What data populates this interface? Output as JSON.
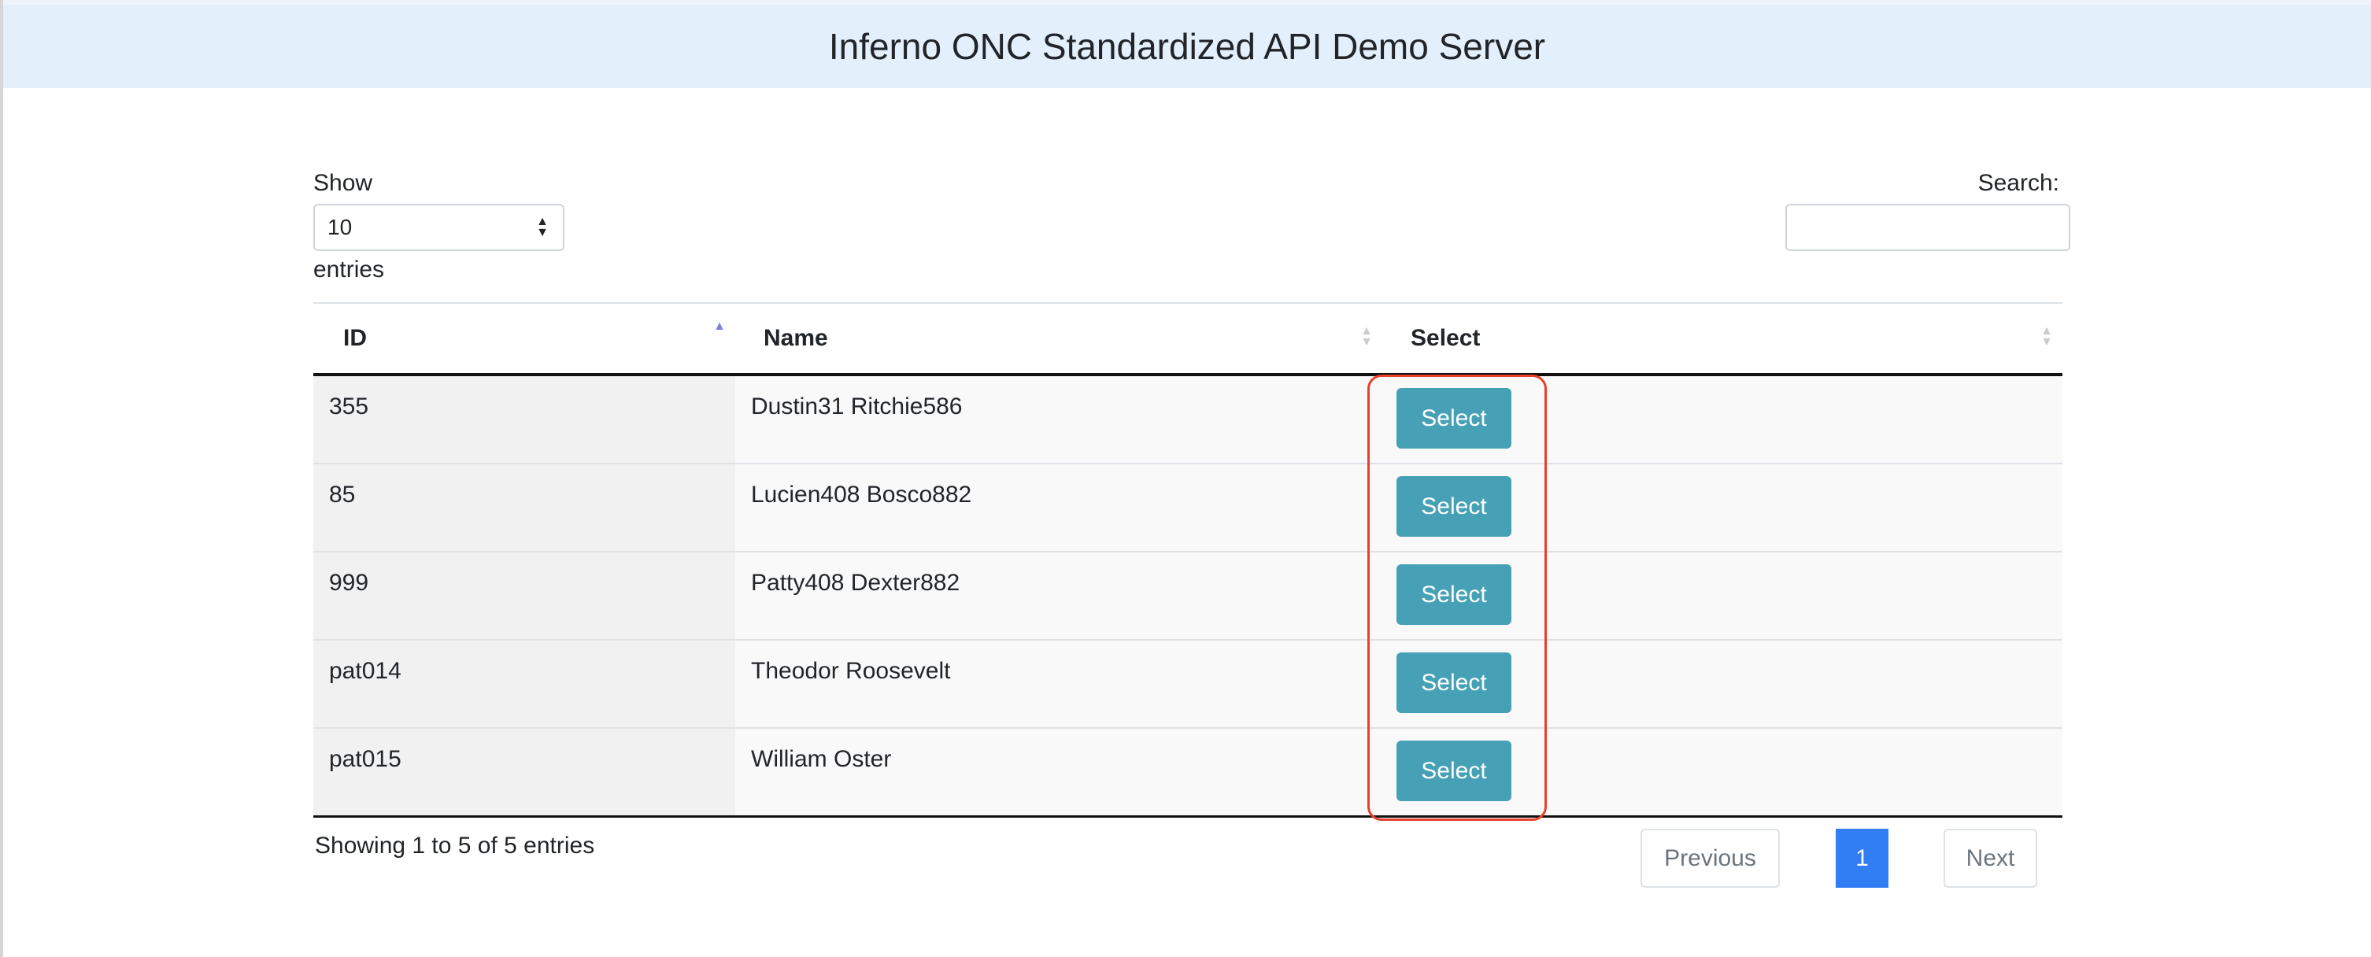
{
  "header": {
    "title": "Inferno ONC Standardized API Demo Server"
  },
  "length": {
    "show_label": "Show",
    "value": "10",
    "entries_label": "entries"
  },
  "search": {
    "label": "Search:",
    "value": ""
  },
  "table": {
    "columns": [
      "ID",
      "Name",
      "Select"
    ],
    "rows": [
      {
        "id": "355",
        "name": "Dustin31 Ritchie586",
        "action": "Select"
      },
      {
        "id": "85",
        "name": "Lucien408 Bosco882",
        "action": "Select"
      },
      {
        "id": "999",
        "name": "Patty408 Dexter882",
        "action": "Select"
      },
      {
        "id": "pat014",
        "name": "Theodor Roosevelt",
        "action": "Select"
      },
      {
        "id": "pat015",
        "name": "William Oster",
        "action": "Select"
      }
    ]
  },
  "footer": {
    "info": "Showing 1 to 5 of 5 entries",
    "previous": "Previous",
    "current_page": "1",
    "next": "Next"
  },
  "colors": {
    "header_bg": "#e3f0fb",
    "select_button": "#46a1b6",
    "active_page": "#317ef4",
    "highlight": "#e8402b",
    "sort_active": "#7b7fe0"
  }
}
